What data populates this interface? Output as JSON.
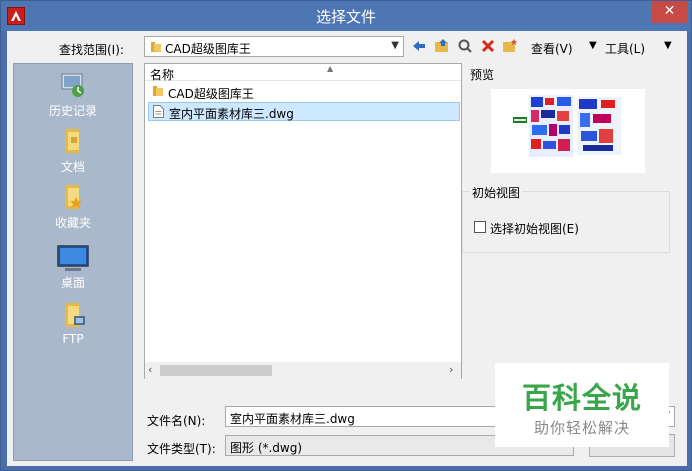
{
  "window": {
    "title": "选择文件"
  },
  "toolbar": {
    "lookin_label": "查找范围(I):",
    "lookin_value": "CAD超级图库王",
    "view_label": "查看(V)",
    "tools_label": "工具(L)"
  },
  "places": [
    {
      "label": "历史记录",
      "icon": "history-icon"
    },
    {
      "label": "文档",
      "icon": "documents-folder-icon"
    },
    {
      "label": "收藏夹",
      "icon": "favorites-folder-icon"
    },
    {
      "label": "桌面",
      "icon": "desktop-icon"
    },
    {
      "label": "FTP",
      "icon": "ftp-icon"
    }
  ],
  "filelist": {
    "column_name": "名称",
    "items": [
      {
        "label": "CAD超级图库王",
        "type": "folder"
      },
      {
        "label": "室内平面素材库三.dwg",
        "type": "dwg",
        "selected": true
      }
    ]
  },
  "preview": {
    "label": "预览"
  },
  "initial_view": {
    "group_label": "初始视图",
    "checkbox_label": "选择初始视图(E)",
    "checked": false
  },
  "filename": {
    "label": "文件名(N):",
    "value": "室内平面素材库三.dwg"
  },
  "filetype": {
    "label": "文件类型(T):",
    "value": "图形 (*.dwg)"
  },
  "watermark": {
    "title": "百科全说",
    "subtitle": "助你轻松解决"
  },
  "colors": {
    "titlebar": "#4d76b3",
    "close": "#c74a44",
    "selection": "#cde8ff",
    "watermark": "#3aa64b"
  }
}
